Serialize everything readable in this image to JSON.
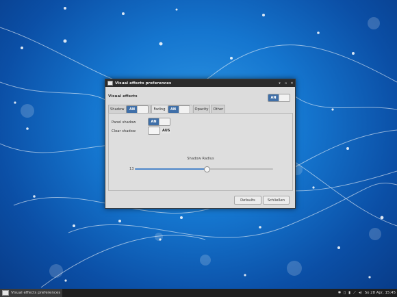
{
  "window": {
    "title": "Visual effects preferences",
    "controls": [
      "▾",
      "▫",
      "✕"
    ],
    "section_title": "Visual effects",
    "master_toggle": "AN",
    "tabs": [
      {
        "label": "Shadow",
        "toggle": "AN"
      },
      {
        "label": "Fading",
        "toggle": "AN"
      },
      {
        "label": "Opacity"
      },
      {
        "label": "Other"
      }
    ],
    "panel_shadow": {
      "label": "Panel shadow",
      "toggle": "AN"
    },
    "clear_shadow": {
      "label": "Clear shadow",
      "toggle": "AUS"
    },
    "slider": {
      "label": "Shadow Radius",
      "value": "13",
      "fraction": 0.52
    },
    "buttons": {
      "defaults": "Defaults",
      "close": "Schließen"
    }
  },
  "taskbar": {
    "task_label": "Visual effects preferences",
    "clock": "So 28 Apr,  15:45"
  },
  "colors": {
    "accent": "#3f6fa8",
    "desktop": "#1576cf"
  }
}
